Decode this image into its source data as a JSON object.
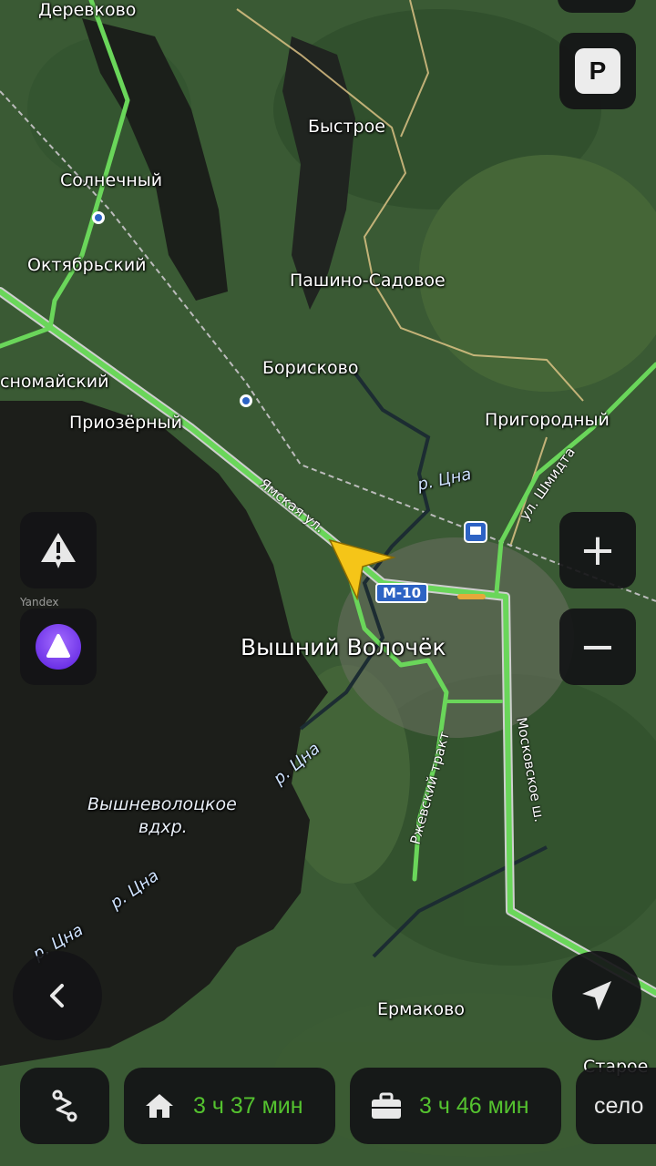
{
  "map": {
    "watermark": "Yandex",
    "road_shield": "М-10",
    "places": [
      {
        "id": "derevkovo",
        "name": "Деревково"
      },
      {
        "id": "bystroe",
        "name": "Быстрое"
      },
      {
        "id": "solnechny",
        "name": "Солнечный"
      },
      {
        "id": "oktyabrsky",
        "name": "Октябрьский"
      },
      {
        "id": "pashino",
        "name": "Пашино-Садовое"
      },
      {
        "id": "borisk",
        "name": "Борисково"
      },
      {
        "id": "krasnomaisky",
        "name": "сномайский"
      },
      {
        "id": "priozerny",
        "name": "Приозёрный"
      },
      {
        "id": "prigorodny",
        "name": "Пригородный"
      },
      {
        "id": "city",
        "name": "Вышний Волочёк"
      },
      {
        "id": "ermakovo",
        "name": "Ермаково"
      },
      {
        "id": "staroe",
        "name": "Старое"
      }
    ],
    "rivers": [
      "р. Цна",
      "р. Цна",
      "р. Цна",
      "р. Цна"
    ],
    "lake": [
      "Вышневолоцкое",
      "вдхр."
    ],
    "streets": [
      "Ямская ул.",
      "ул. Шмидта",
      "Московское ш.",
      "Ржевский тракт"
    ]
  },
  "controls": {
    "parking_label": "P",
    "zoom_in_label": "+",
    "zoom_out_label": "−"
  },
  "bottom_bar": {
    "home_eta": "3 ч 37 мин",
    "work_eta": "3 ч 46 мин",
    "extra": "село"
  },
  "colors": {
    "traffic_green": "#6ad65a",
    "eta_green": "#54c22f",
    "cursor_yellow": "#f5c518",
    "alice_purple": "#7a3ff0",
    "control_bg": "#141416"
  }
}
